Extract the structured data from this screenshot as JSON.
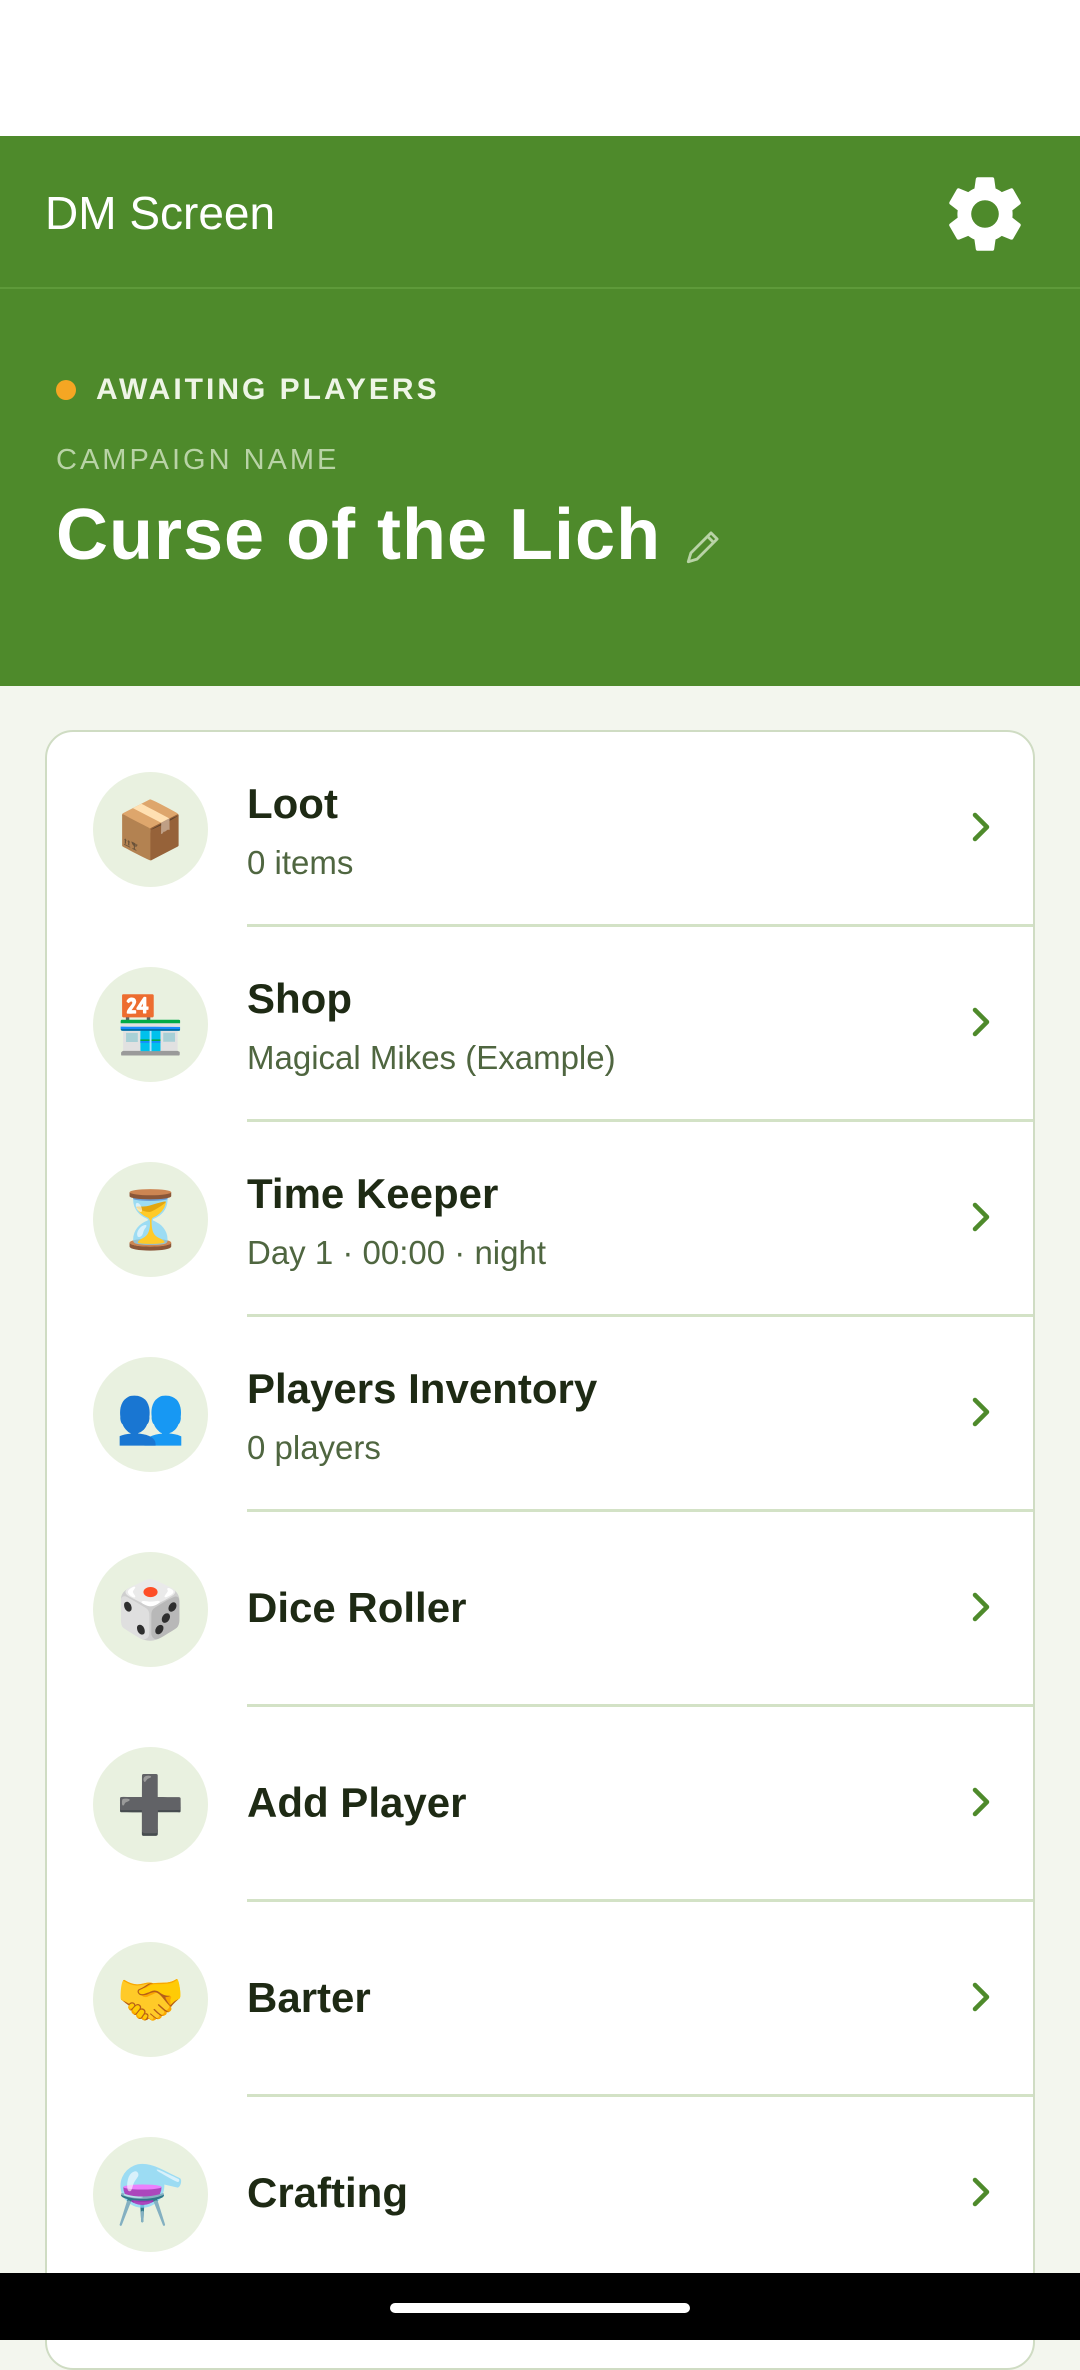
{
  "appbar": {
    "title": "DM Screen",
    "settings_icon": "gear-icon"
  },
  "hero": {
    "status": "AWAITING PLAYERS",
    "status_color": "#f5a623",
    "campaign_label": "CAMPAIGN NAME",
    "campaign_name": "Curse of the Lich",
    "edit_icon": "pencil-icon"
  },
  "colors": {
    "primary": "#4e8a2b",
    "card_bg": "#ffffff",
    "icon_bg": "#e9f1e0",
    "title_text": "#1e2a14",
    "subtitle_text": "#4f6640"
  },
  "menu": {
    "items": [
      {
        "title": "Loot",
        "subtitle": "0 items",
        "icon": "📦",
        "icon_name": "package-icon"
      },
      {
        "title": "Shop",
        "subtitle": "Magical Mikes (Example)",
        "icon": "🏪",
        "icon_name": "store-icon"
      },
      {
        "title": "Time Keeper",
        "subtitle": "Day 1 · 00:00 · night",
        "icon": "⏳",
        "icon_name": "hourglass-icon"
      },
      {
        "title": "Players Inventory",
        "subtitle": "0 players",
        "icon": "👥",
        "icon_name": "people-icon"
      },
      {
        "title": "Dice Roller",
        "subtitle": "",
        "icon": "🎲",
        "icon_name": "dice-icon"
      },
      {
        "title": "Add Player",
        "subtitle": "",
        "icon": "➕",
        "icon_name": "plus-icon"
      },
      {
        "title": "Barter",
        "subtitle": "",
        "icon": "🤝",
        "icon_name": "handshake-icon"
      },
      {
        "title": "Crafting",
        "subtitle": "",
        "icon": "⚗️",
        "icon_name": "alembic-icon"
      }
    ]
  }
}
